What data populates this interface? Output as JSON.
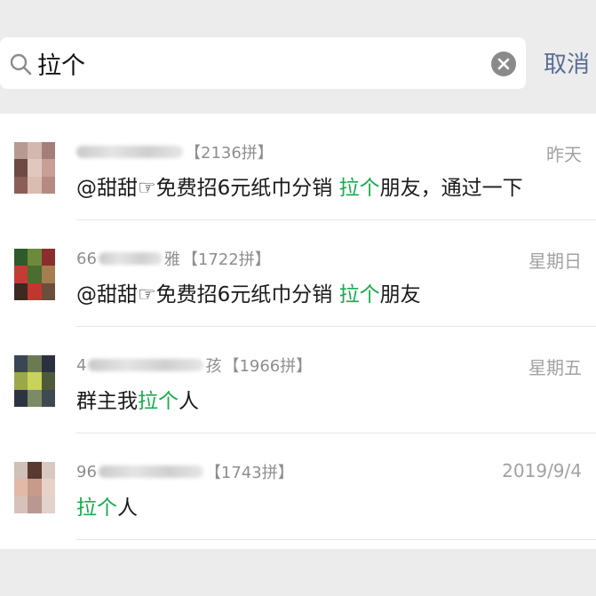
{
  "search": {
    "query": "拉个",
    "cancel_label": "取消"
  },
  "results": [
    {
      "name_suffix": "",
      "group_count": "【2136拼】",
      "time": "昨天",
      "message_before": "@甜甜☞免费招6元纸巾分销 ",
      "message_highlight": "拉个",
      "message_after": "朋友，通过一下"
    },
    {
      "name_prefix": "66",
      "name_suffix": "雅",
      "group_count": "【1722拼】",
      "time": "星期日",
      "message_before": "@甜甜☞免费招6元纸巾分销 ",
      "message_highlight": "拉个",
      "message_after": "朋友"
    },
    {
      "name_prefix": "4",
      "name_suffix": "孩",
      "group_count": "【1966拼】",
      "time": "星期五",
      "message_before": "群主我",
      "message_highlight": "拉个",
      "message_after": "人"
    },
    {
      "name_prefix": "96",
      "name_suffix": "",
      "group_count": "【1743拼】",
      "time": "2019/9/4",
      "message_before": "",
      "message_highlight": "拉个",
      "message_after": "人"
    }
  ],
  "colors": {
    "highlight": "#1aaa4e",
    "cancel": "#5a6d93",
    "background": "#ececec"
  }
}
